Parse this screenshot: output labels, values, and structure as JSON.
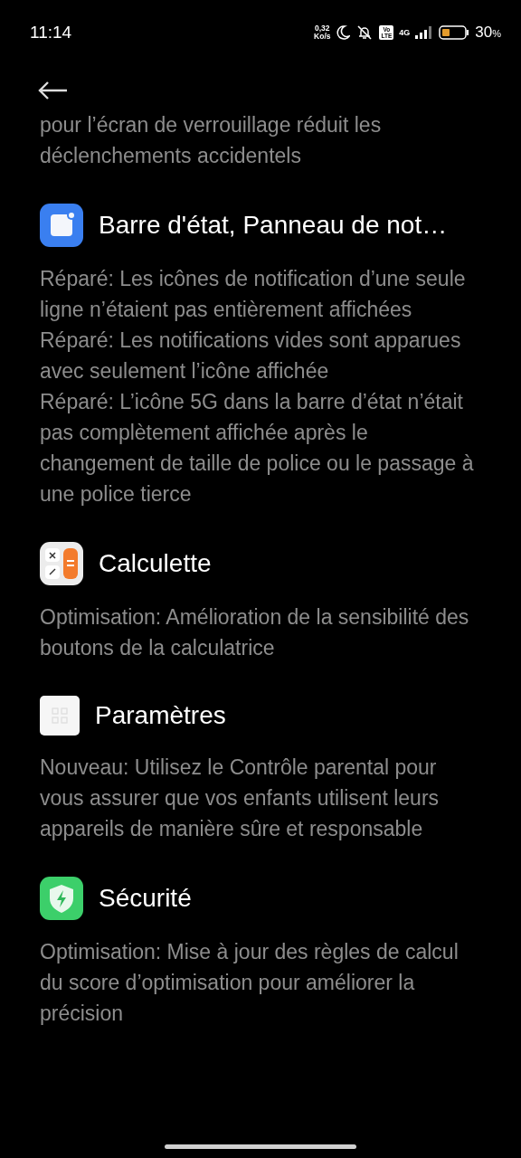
{
  "status_bar": {
    "time": "11:14",
    "speed_value": "0,32",
    "speed_unit": "Ko/s",
    "volte_top": "Vo",
    "volte_bottom": "LTE",
    "network": "4G",
    "battery_percent": "30",
    "percent_sign": "%"
  },
  "intro": "pour l’écran de verrouillage réduit les déclenchements accidentels",
  "sections": [
    {
      "kind": "status-bar",
      "title": "Barre d'état, Panneau de not…",
      "notes": [
        "Réparé: Les icônes de notification d’une seule ligne n’étaient pas entièrement affichées",
        "Réparé: Les notifications vides sont apparues avec seulement l’icône affichée",
        "Réparé: L’icône 5G dans la barre d’état n’était pas complètement affichée après le changement de taille de police ou le passage à une police tierce"
      ]
    },
    {
      "kind": "calculator",
      "title": "Calculette",
      "notes": [
        "Optimisation: Amélioration de la sensibilité des boutons de la calculatrice"
      ]
    },
    {
      "kind": "settings",
      "title": "Paramètres",
      "notes": [
        "Nouveau: Utilisez le Contrôle parental pour vous assurer que vos enfants utilisent leurs appareils de manière sûre et responsable"
      ]
    },
    {
      "kind": "security",
      "title": "Sécurité",
      "notes": [
        "Optimisation: Mise à jour des règles de calcul du score d’optimisation pour améliorer la précision"
      ]
    }
  ]
}
